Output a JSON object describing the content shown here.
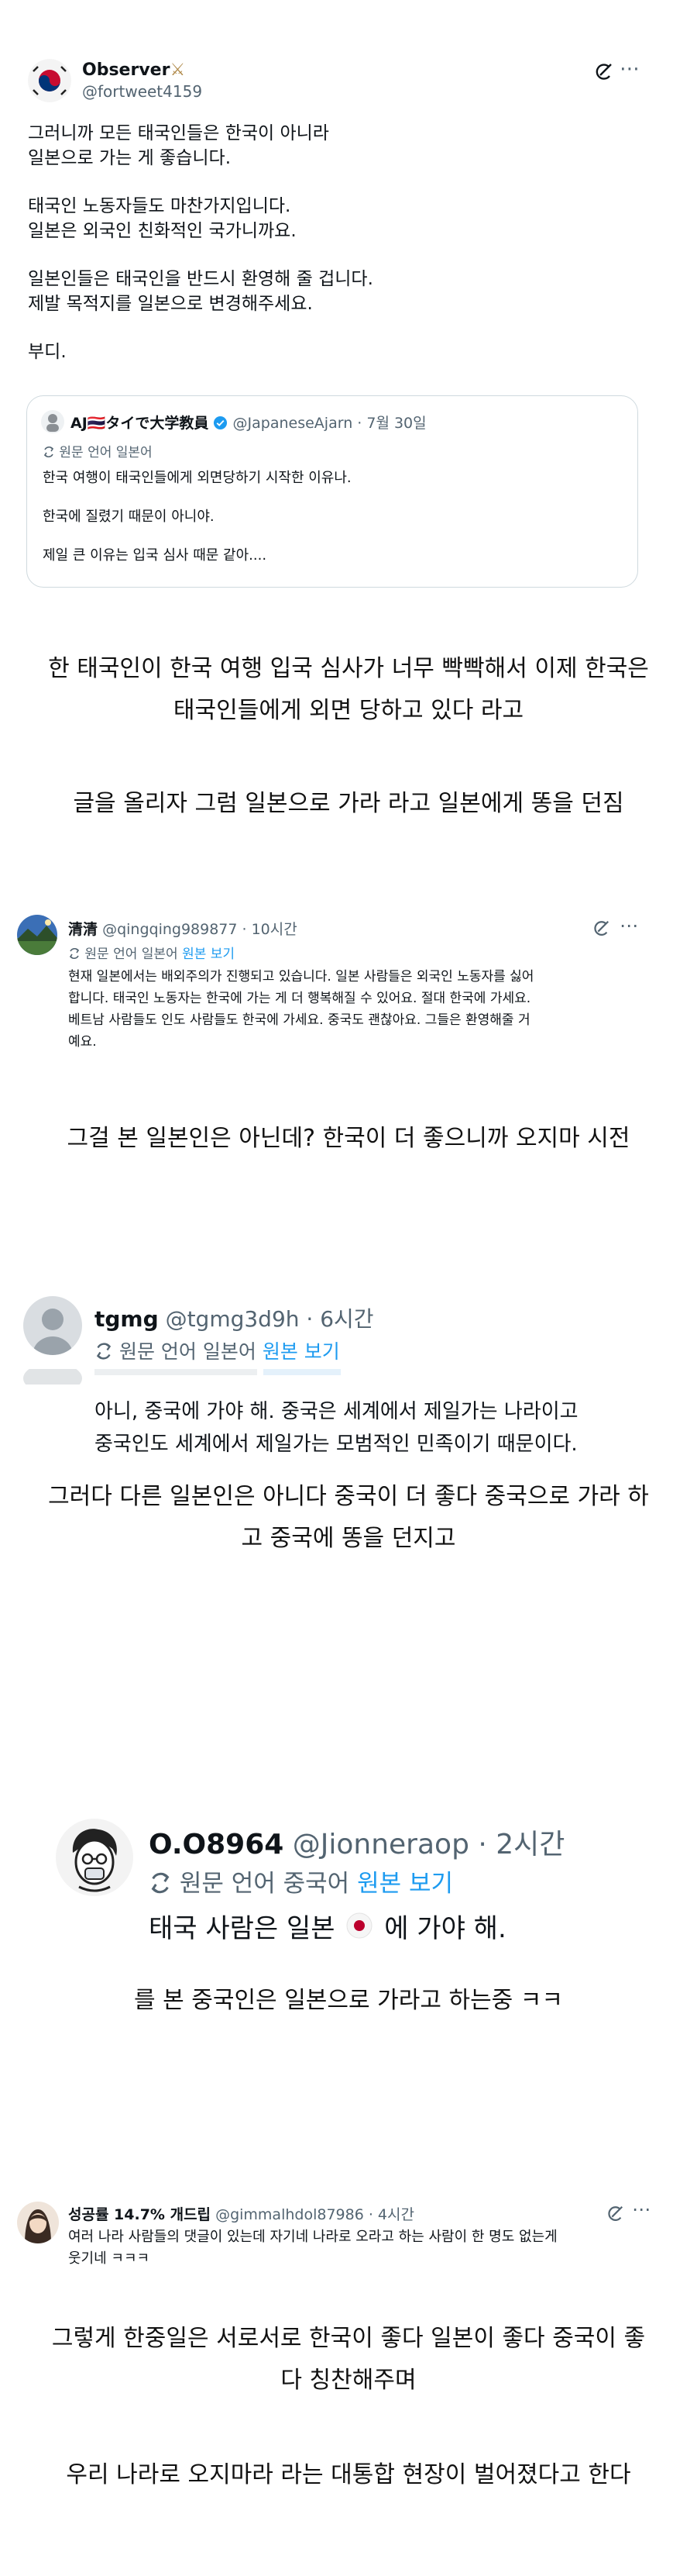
{
  "main_tweet": {
    "author_name": "Observer",
    "author_emoji": "⚔",
    "handle": "@fortweet4159",
    "lines": [
      "그러니까 모든 태국인들은 한국이 아니라",
      "일본으로 가는 게 좋습니다.",
      "태국인 노동자들도 마찬가지입니다.",
      "일본은 외국인 친화적인 국가니까요.",
      "일본인들은 태국인을 반드시 환영해 줄 겁니다.",
      "제발 목적지를 일본으로 변경해주세요.",
      "부디."
    ],
    "more": "⋯",
    "quote": {
      "author_name": "AJ🇹🇭タイで大学教員",
      "handle_time": "@JapaneseAjarn · 7월 30일",
      "translate_note": "원문 언어 일본어",
      "lines": [
        "한국 여행이 태국인들에게 외면당하기 시작한 이유나.",
        "한국에 질렸기 때문이 아니야.",
        "제일 큰 이유는 입국 심사 때문 같아...."
      ]
    }
  },
  "captions": {
    "c1_line1": "한 태국인이 한국 여행 입국 심사가 너무 빡빡해서 이제 한국은",
    "c1_line2": "태국인들에게 외면 당하고 있다 라고",
    "c2": "글을 올리자 그럼 일본으로 가라 라고 일본에게 똥을 던짐",
    "c3": "그걸 본 일본인은 아닌데? 한국이 더 좋으니까 오지마 시전",
    "c4_line1": "그러다 다른 일본인은 아니다 중국이 더 좋다 중국으로 가라 하",
    "c4_line2": "고 중국에 똥을 던지고",
    "c5": "를 본 중국인은 일본으로 가라고 하는중 ㅋㅋ",
    "c6_line1": "그렇게 한중일은 서로서로 한국이 좋다 일본이 좋다 중국이 좋",
    "c6_line2": "다 칭찬해주며",
    "c7": "우리 나라로 오지마라 라는 대통합 현장이 벌어졌다고 한다"
  },
  "reply_qingqing": {
    "author_name": "清清",
    "handle_time": "@qingqing989877 · 10시간",
    "translate_note": "원문 언어 일본어",
    "view_original": "원본 보기",
    "lines": [
      "현재 일본에서는 배외주의가 진행되고 있습니다. 일본 사람들은 외국인 노동자를 싫어",
      "합니다. 태국인 노동자는 한국에 가는 게 더 행복해질 수 있어요. 절대 한국에 가세요.",
      "베트남 사람들도 인도 사람들도 한국에 가세요. 중국도 괜찮아요. 그들은 환영해줄 거",
      "예요."
    ]
  },
  "reply_tgmg": {
    "author_name": "tgmg",
    "handle_time": "@tgmg3d9h · 6시간",
    "translate_note": "원문 언어 일본어",
    "view_original": "원본 보기",
    "lines": [
      "아니, 중국에 가야 해. 중국은 세계에서 제일가는 나라이고",
      "중국인도 세계에서 제일가는 모범적인 민족이기 때문이다."
    ]
  },
  "reply_jionner": {
    "author_name": "O.O8964",
    "handle_time": "@Jionneraop · 2시간",
    "translate_note": "원문 언어 중국어",
    "view_original": "원본 보기",
    "text_before": "태국 사람은 일본",
    "text_after": "에 가야 해."
  },
  "reply_gimmal": {
    "author_name": "성공률 14.7% 개드립",
    "handle_time": "@gimmalhdol87986 · 4시간",
    "more": "⋯",
    "lines": [
      "여러 나라 사람들의 댓글이 있는데 자기네 나라로 오라고 하는 사람이 한 명도 없는게",
      "웃기네 ㅋㅋㅋ"
    ]
  },
  "colors": {
    "text": "#0f1419",
    "muted": "#536471",
    "link": "#1d9bf0",
    "border": "#cfd9de",
    "japan_red": "#bc002d"
  }
}
